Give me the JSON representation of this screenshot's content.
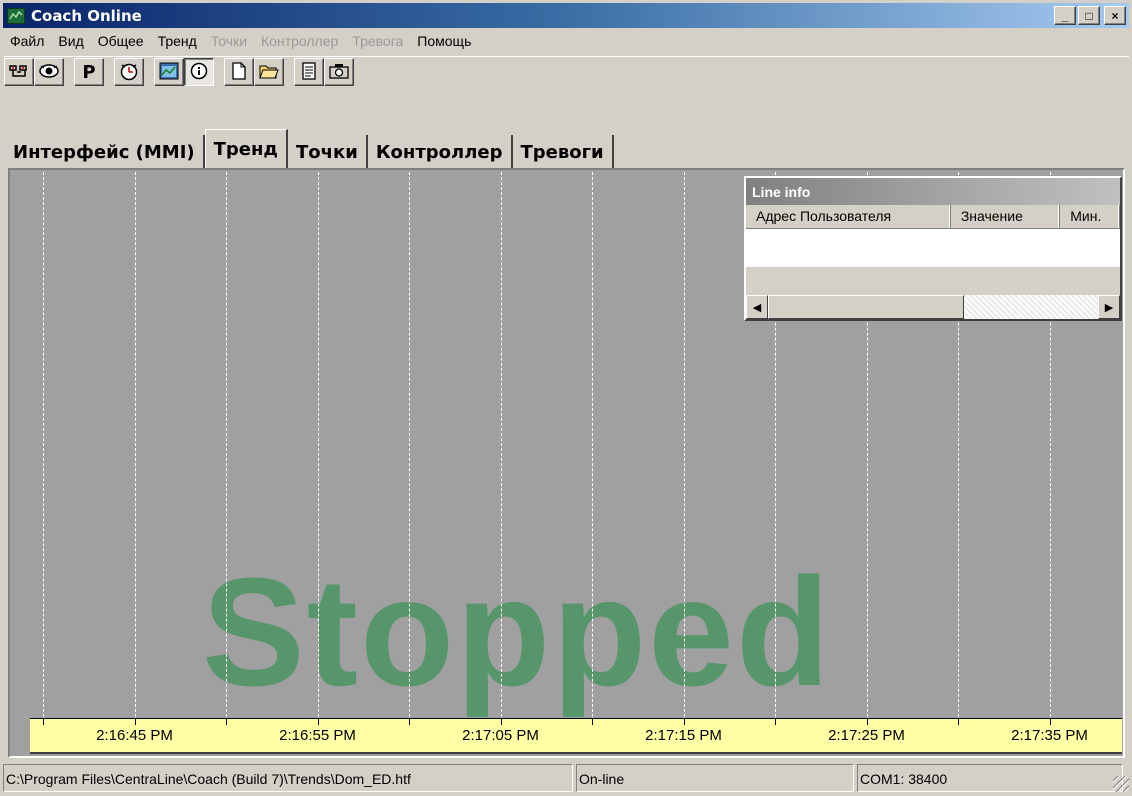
{
  "window": {
    "title": "Coach Online",
    "minimize": "_",
    "maximize": "□",
    "close": "×"
  },
  "menu": [
    {
      "label": "Файл",
      "disabled": false
    },
    {
      "label": "Вид",
      "disabled": false
    },
    {
      "label": "Общее",
      "disabled": false
    },
    {
      "label": "Тренд",
      "disabled": false
    },
    {
      "label": "Точки",
      "disabled": true
    },
    {
      "label": "Контроллер",
      "disabled": true
    },
    {
      "label": "Тревога",
      "disabled": true
    },
    {
      "label": "Помощь",
      "disabled": false
    }
  ],
  "toolbar": {
    "buttons": [
      "points-icon",
      "eye-icon",
      "p-icon",
      "clock-icon",
      "trend-window-icon",
      "info-icon",
      "new-file-icon",
      "open-folder-icon",
      "report-icon",
      "camera-icon"
    ],
    "p_label": "P"
  },
  "tabs": [
    {
      "label": "Интерфейс (MMI)",
      "active": false
    },
    {
      "label": "Тренд",
      "active": true
    },
    {
      "label": "Точки",
      "active": false
    },
    {
      "label": "Контроллер",
      "active": false
    },
    {
      "label": "Тревоги",
      "active": false
    }
  ],
  "trend": {
    "overlay_text": "Stopped",
    "time_labels": [
      "2:16:45 PM",
      "2:16:55 PM",
      "2:17:05 PM",
      "2:17:15 PM",
      "2:17:25 PM",
      "2:17:35 PM"
    ],
    "colors": {
      "plot_bg": "#a0a0a0",
      "overlay": "#57966a",
      "axis_bg": "#ffffa5"
    }
  },
  "line_info": {
    "title": "Line info",
    "columns": [
      "Адрес Пользователя",
      "Значение",
      "Мин."
    ]
  },
  "status": {
    "path": "C:\\Program Files\\CentraLine\\Coach (Build 7)\\Trends\\Dom_ED.htf",
    "connection": "On-line",
    "port": "COM1: 38400"
  }
}
